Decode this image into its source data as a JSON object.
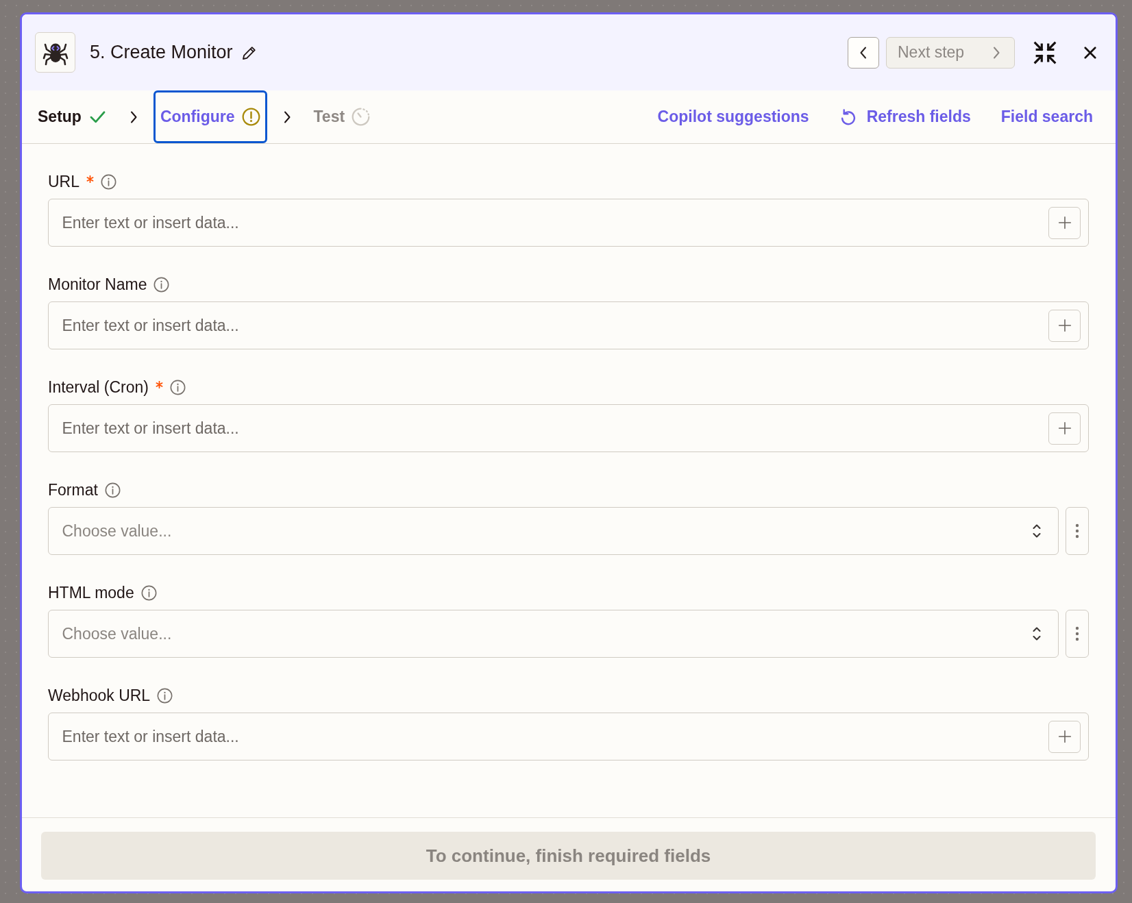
{
  "dialog": {
    "title": "5. Create Monitor",
    "prev_button": {
      "disabled": false
    },
    "next_button": {
      "label": "Next step",
      "disabled": true
    }
  },
  "steps": [
    {
      "label": "Setup",
      "kind": "done",
      "selected": false
    },
    {
      "label": "Configure",
      "kind": "warning",
      "selected": true
    },
    {
      "label": "Test",
      "kind": "pending",
      "selected": false
    }
  ],
  "actions": [
    {
      "label": "Copilot suggestions",
      "icon": false
    },
    {
      "label": "Refresh fields",
      "icon": true
    },
    {
      "label": "Field search",
      "icon": false
    }
  ],
  "fields": [
    {
      "label": "URL",
      "required": true,
      "kind": "text",
      "placeholder": "Enter text or insert data..."
    },
    {
      "label": "Monitor Name",
      "required": false,
      "kind": "text",
      "placeholder": "Enter text or insert data..."
    },
    {
      "label": "Interval (Cron)",
      "required": true,
      "kind": "text",
      "placeholder": "Enter text or insert data..."
    },
    {
      "label": "Format",
      "required": false,
      "kind": "select",
      "placeholder": "Choose value..."
    },
    {
      "label": "HTML mode",
      "required": false,
      "kind": "select",
      "placeholder": "Choose value..."
    },
    {
      "label": "Webhook URL",
      "required": false,
      "kind": "text",
      "placeholder": "Enter text or insert data..."
    }
  ],
  "footer": {
    "button": {
      "label": "To continue, finish required fields",
      "disabled": true
    }
  }
}
